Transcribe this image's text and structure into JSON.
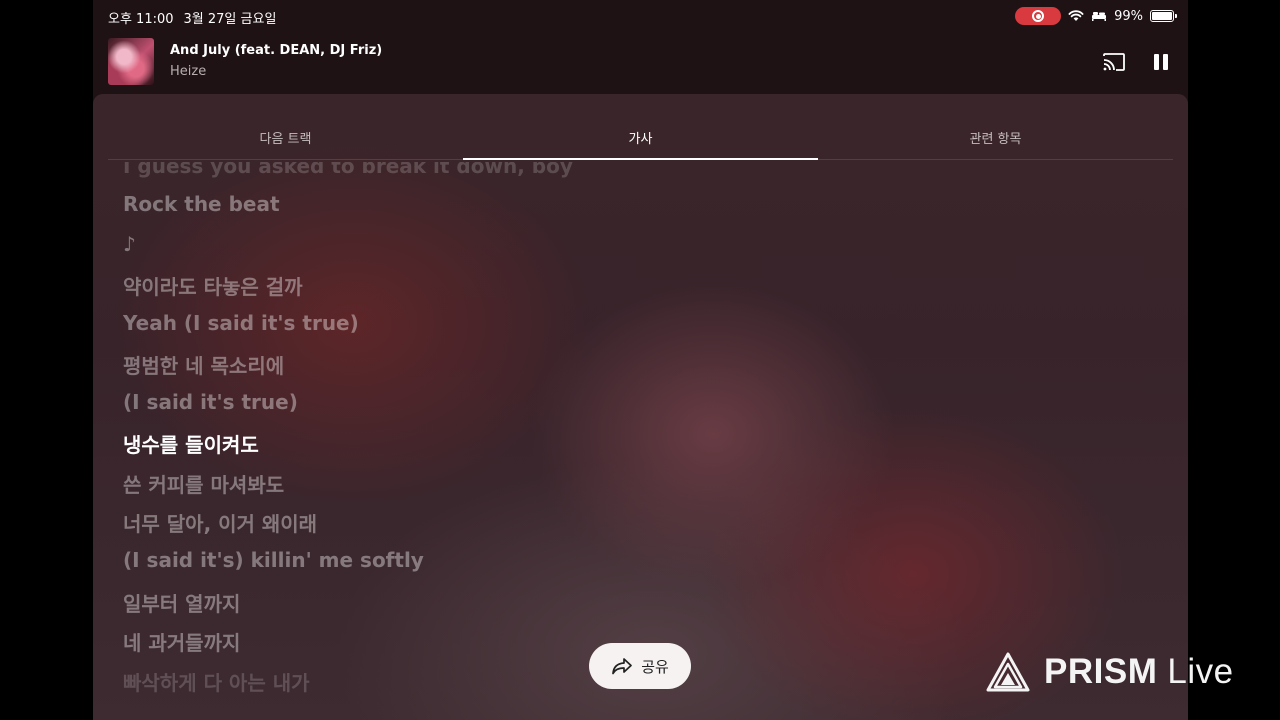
{
  "status_bar": {
    "time": "오후 11:00",
    "date": "3월 27일 금요일",
    "battery": "99%",
    "battery_level": 0.99,
    "record_color": "#d83a3f"
  },
  "now_playing": {
    "title": "And July (feat. DEAN, DJ Friz)",
    "artist": "Heize"
  },
  "tabs": [
    {
      "label": "다음 트랙",
      "active": false
    },
    {
      "label": "가사",
      "active": true
    },
    {
      "label": "관련 항목",
      "active": false
    }
  ],
  "lyrics": [
    "I guess you asked to break it down, boy",
    "Rock the beat",
    "♪",
    "약이라도 타놓은 걸까",
    "Yeah (I said it's true)",
    "평범한 네 목소리에",
    "(I said it's true)",
    "냉수를 들이켜도",
    "쓴 커피를 마셔봐도",
    "너무 달아, 이거 왜이래",
    "(I said it's) killin' me softly",
    "일부터 열까지",
    "네 과거들까지",
    "빠삭하게 다 아는 내가"
  ],
  "current_lyric_index": 7,
  "share_label": "공유",
  "watermark": {
    "brand": "PRISM",
    "suffix": "Live"
  },
  "icons": {
    "cast": "cast-icon",
    "pause": "pause-icon",
    "share": "share-icon",
    "wifi": "wifi-icon",
    "battery": "battery-icon",
    "record": "record-icon"
  }
}
